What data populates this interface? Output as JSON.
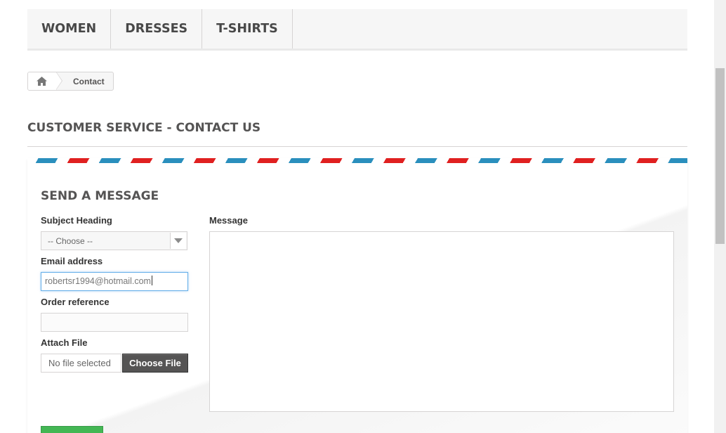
{
  "menu": {
    "items": [
      {
        "label": "WOMEN"
      },
      {
        "label": "DRESSES"
      },
      {
        "label": "T-SHIRTS"
      }
    ]
  },
  "breadcrumb": {
    "home_icon": "home-icon",
    "current": "Contact"
  },
  "page_heading": "CUSTOMER SERVICE - CONTACT US",
  "form": {
    "title": "SEND A MESSAGE",
    "subject_label": "Subject Heading",
    "subject_value": "-- Choose --",
    "email_label": "Email address",
    "email_value": "robertsr1994@hotmail.com",
    "order_label": "Order reference",
    "order_value": "",
    "attach_label": "Attach File",
    "file_status": "No file selected",
    "file_button": "Choose File",
    "message_label": "Message",
    "message_value": ""
  },
  "colors": {
    "airmail_blue": "#2a8fbd",
    "airmail_red": "#e02020",
    "submit_green": "#43b754",
    "focus_blue": "#66afe9"
  }
}
